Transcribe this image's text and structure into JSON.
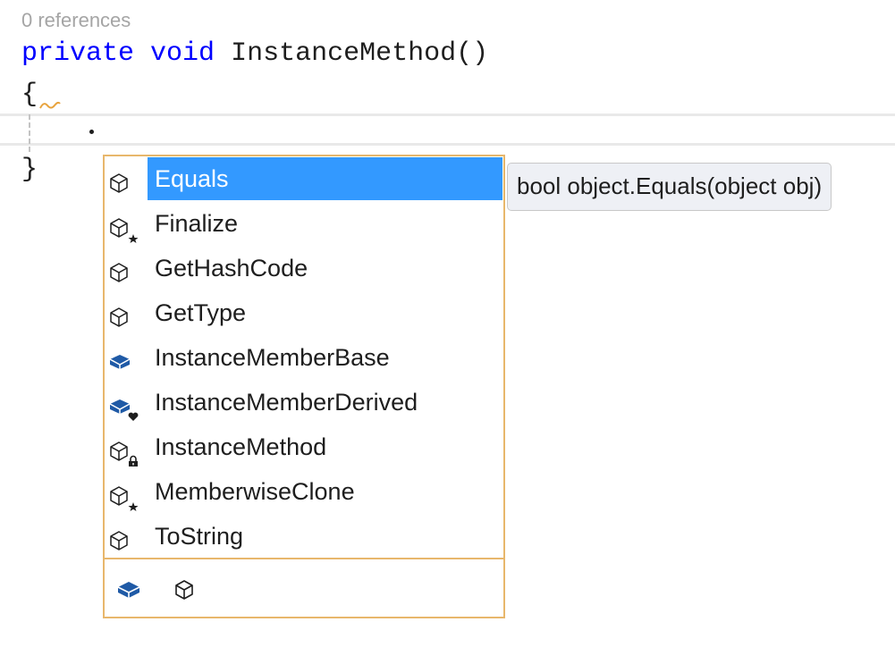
{
  "editor": {
    "codelens": "0 references",
    "signature": {
      "kw_private": "private",
      "kw_void": "void",
      "method_name": "InstanceMethod()"
    },
    "open_brace": "{",
    "close_brace": "}"
  },
  "completion": {
    "selected_index": 0,
    "items": [
      {
        "label": "Equals",
        "icon": "method-icon"
      },
      {
        "label": "Finalize",
        "icon": "method-protected-icon"
      },
      {
        "label": "GetHashCode",
        "icon": "method-icon"
      },
      {
        "label": "GetType",
        "icon": "method-icon"
      },
      {
        "label": "InstanceMemberBase",
        "icon": "extension-method-icon"
      },
      {
        "label": "InstanceMemberDerived",
        "icon": "extension-method-internal-icon"
      },
      {
        "label": "InstanceMethod",
        "icon": "method-private-icon"
      },
      {
        "label": "MemberwiseClone",
        "icon": "method-protected-icon"
      },
      {
        "label": "ToString",
        "icon": "method-icon"
      }
    ],
    "filters": [
      {
        "icon": "extension-method-filter-icon"
      },
      {
        "icon": "method-filter-icon"
      }
    ]
  },
  "tooltip": {
    "text": "bool object.Equals(object obj)"
  },
  "colors": {
    "keyword": "#0000ff",
    "selection": "#3399ff",
    "popup_border": "#e8b76c",
    "icon_fill": "#1f5aa6"
  }
}
